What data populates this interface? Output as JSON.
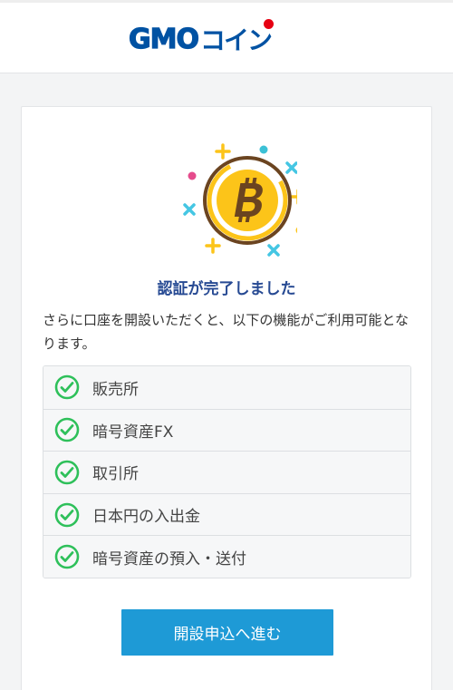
{
  "header": {
    "logo": {
      "primary": "GMO",
      "secondary": "コイン",
      "brand_color": "#0052a3",
      "dot_color": "#e60012"
    }
  },
  "card": {
    "illustration": {
      "icon": "bitcoin-coin-icon",
      "coin_color": "#fcc419",
      "ring_color": "#6b4420"
    },
    "title": "認証が完了しました",
    "description": "さらに口座を開設いただくと、以下の機能がご利用可能となります。",
    "features": [
      {
        "label": "販売所",
        "icon": "check-circle-icon"
      },
      {
        "label": "暗号資産FX",
        "icon": "check-circle-icon"
      },
      {
        "label": "取引所",
        "icon": "check-circle-icon"
      },
      {
        "label": "日本円の入出金",
        "icon": "check-circle-icon"
      },
      {
        "label": "暗号資産の預入・送付",
        "icon": "check-circle-icon"
      }
    ],
    "check_color": "#2ec05a",
    "cta_label": "開設申込へ進む",
    "cta_color": "#1e9ad6"
  }
}
